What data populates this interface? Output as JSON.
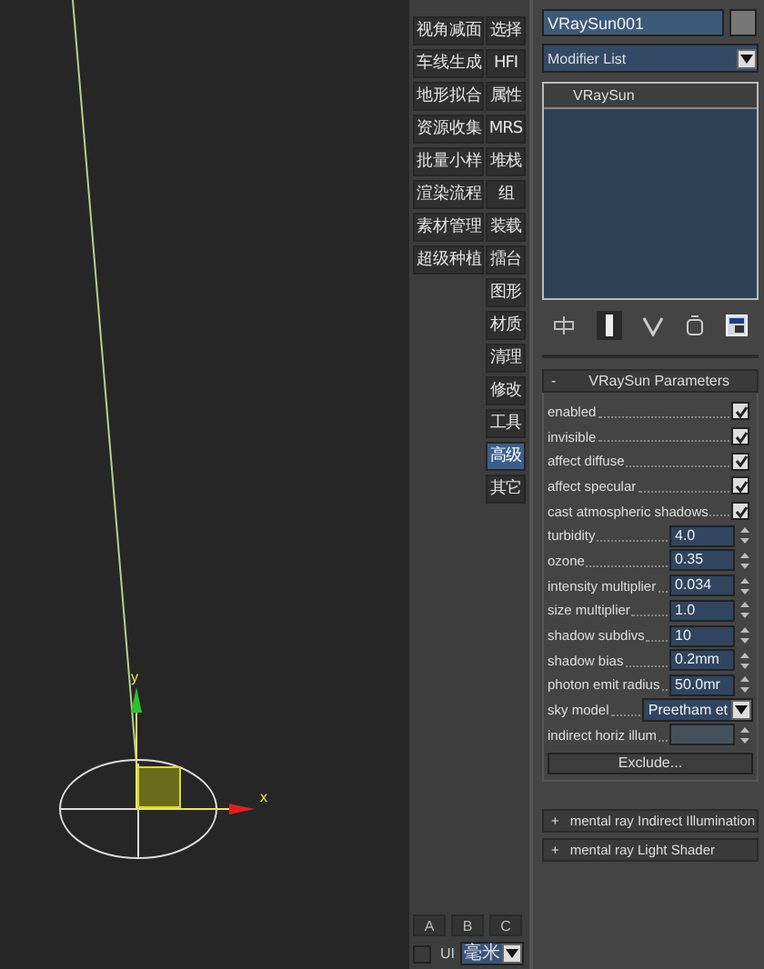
{
  "viewport": {
    "axis_labels": {
      "y": "y",
      "x": "x"
    }
  },
  "command_buttons": {
    "left": [
      "视角减面",
      "车线生成",
      "地形拟合",
      "资源收集",
      "批量小样",
      "渲染流程",
      "素材管理",
      "超级种植"
    ],
    "right": [
      {
        "label": "选择",
        "selected": false
      },
      {
        "label": "HFI",
        "selected": false
      },
      {
        "label": "属性",
        "selected": false
      },
      {
        "label": "MRS",
        "selected": false
      },
      {
        "label": "堆栈",
        "selected": false
      },
      {
        "label": "组",
        "selected": false
      },
      {
        "label": "装载",
        "selected": false
      },
      {
        "label": "擂台",
        "selected": false
      },
      {
        "label": "图形",
        "selected": false
      },
      {
        "label": "材质",
        "selected": false
      },
      {
        "label": "清理",
        "selected": false
      },
      {
        "label": "修改",
        "selected": false
      },
      {
        "label": "工具",
        "selected": false
      },
      {
        "label": "高级",
        "selected": true
      },
      {
        "label": "其它",
        "selected": false
      }
    ]
  },
  "bottom_bar": {
    "tabs": [
      "A",
      "B",
      "C"
    ],
    "ui_checkbox": {
      "label": "UI",
      "checked": false
    },
    "units": "毫米"
  },
  "object_name": "VRaySun001",
  "modifier_list": "Modifier List",
  "modifier_stack": [
    "VRaySun"
  ],
  "rollout": {
    "title": "VRaySun Parameters",
    "collapse": "-",
    "params": [
      {
        "kind": "check",
        "label": "enabled",
        "checked": true
      },
      {
        "kind": "check",
        "label": "invisible",
        "checked": true
      },
      {
        "kind": "check",
        "label": "affect diffuse",
        "checked": true
      },
      {
        "kind": "check",
        "label": "affect specular",
        "checked": true
      },
      {
        "kind": "check",
        "label": "cast atmospheric shadows",
        "checked": true
      },
      {
        "kind": "spinner",
        "label": "turbidity",
        "value": "4.0",
        "disabled": false
      },
      {
        "kind": "spinner",
        "label": "ozone",
        "value": "0.35",
        "disabled": false
      },
      {
        "kind": "spinner",
        "label": "intensity multiplier",
        "value": "0.034",
        "disabled": false
      },
      {
        "kind": "spinner",
        "label": "size multiplier",
        "value": "1.0",
        "disabled": false
      },
      {
        "kind": "spinner",
        "label": "shadow subdivs",
        "value": "10",
        "disabled": false
      },
      {
        "kind": "spinner",
        "label": "shadow bias",
        "value": "0.2mm",
        "disabled": false
      },
      {
        "kind": "spinner",
        "label": "photon emit radius",
        "value": "50.0mr",
        "disabled": false
      },
      {
        "kind": "dropdown",
        "label": "sky model",
        "value": "Preetham et"
      },
      {
        "kind": "spinner",
        "label": "indirect horiz illum",
        "disabled": true
      }
    ],
    "button": "Exclude..."
  },
  "collapsed_rollouts": [
    {
      "sign": "+",
      "title": "mental ray Indirect Illumination"
    },
    {
      "sign": "+",
      "title": "mental ray Light Shader"
    }
  ]
}
